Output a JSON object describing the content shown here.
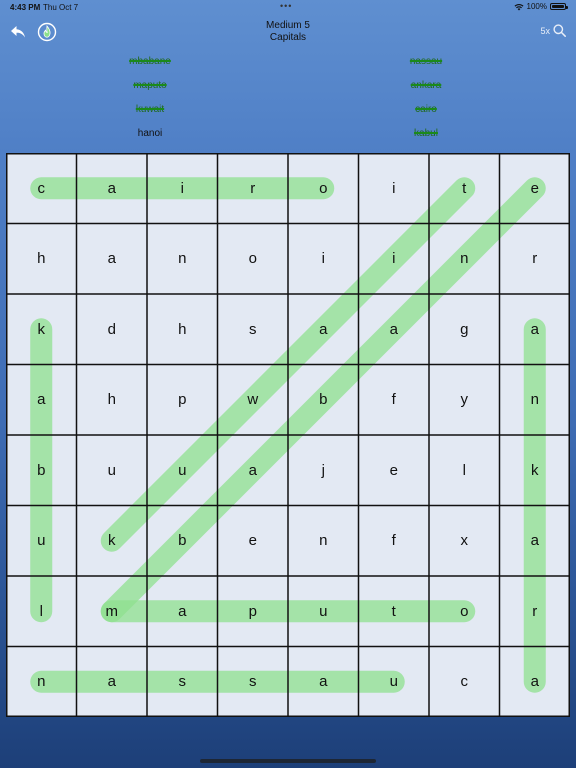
{
  "status": {
    "time": "4:43 PM",
    "date": "Thu Oct 7",
    "battery": "100%"
  },
  "header": {
    "level": "Medium 5",
    "category": "Capitals",
    "hint_count": "5x"
  },
  "icons": {
    "back": "back-arrow-icon",
    "hint": "flame-icon",
    "search": "magnifier-icon"
  },
  "colors": {
    "highlight": "#8fe08f",
    "found_word": "#1b8a1b"
  },
  "words": [
    {
      "text": "mbabane",
      "found": true
    },
    {
      "text": "nassau",
      "found": true
    },
    {
      "text": "maputo",
      "found": true
    },
    {
      "text": "ankara",
      "found": true
    },
    {
      "text": "kuwait",
      "found": true
    },
    {
      "text": "cairo",
      "found": true
    },
    {
      "text": "hanoi",
      "found": false
    },
    {
      "text": "kabul",
      "found": true
    }
  ],
  "grid": [
    [
      "c",
      "a",
      "i",
      "r",
      "o",
      "i",
      "t",
      "e"
    ],
    [
      "h",
      "a",
      "n",
      "o",
      "i",
      "i",
      "n",
      "r"
    ],
    [
      "k",
      "d",
      "h",
      "s",
      "a",
      "a",
      "g",
      "a"
    ],
    [
      "a",
      "h",
      "p",
      "w",
      "b",
      "f",
      "y",
      "n"
    ],
    [
      "b",
      "u",
      "u",
      "a",
      "j",
      "e",
      "l",
      "k"
    ],
    [
      "u",
      "k",
      "b",
      "e",
      "n",
      "f",
      "x",
      "a"
    ],
    [
      "l",
      "m",
      "a",
      "p",
      "u",
      "t",
      "o",
      "r"
    ],
    [
      "n",
      "a",
      "s",
      "s",
      "a",
      "u",
      "c",
      "a"
    ]
  ],
  "found_paths": [
    {
      "word": "cairo",
      "start": [
        0,
        0
      ],
      "end": [
        0,
        4
      ]
    },
    {
      "word": "kabul",
      "start": [
        2,
        0
      ],
      "end": [
        6,
        0
      ]
    },
    {
      "word": "ankara",
      "start": [
        2,
        7
      ],
      "end": [
        7,
        7
      ]
    },
    {
      "word": "maputo",
      "start": [
        6,
        1
      ],
      "end": [
        6,
        6
      ]
    },
    {
      "word": "nassau",
      "start": [
        7,
        0
      ],
      "end": [
        7,
        5
      ]
    },
    {
      "word": "kuwait",
      "start": [
        5,
        1
      ],
      "end": [
        0,
        6
      ]
    },
    {
      "word": "mbabane",
      "start": [
        6,
        1
      ],
      "end": [
        0,
        7
      ]
    }
  ]
}
